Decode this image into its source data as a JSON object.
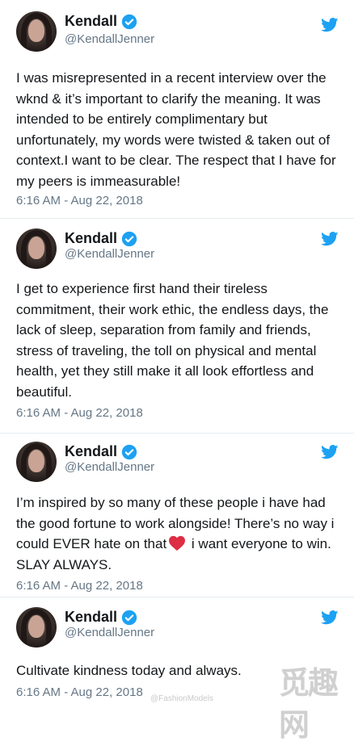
{
  "account": {
    "name": "Kendall",
    "handle": "@KendallJenner",
    "verified": true,
    "brand_color": "#1da1f2"
  },
  "tweets": [
    {
      "text": "I was misrepresented in a recent interview over the wknd & it’s important to clarify the meaning. It was intended to be entirely complimentary but unfortunately, my words were twisted & taken out of context.I want to be clear. The respect that I have for my peers is immeasurable!",
      "timestamp": "6:16 AM - Aug 22, 2018"
    },
    {
      "text": "I get to experience first hand their tireless commitment, their work ethic, the endless days, the lack of sleep, separation from family and friends, stress of traveling, the toll on physical and mental health, yet they still make it all look effortless and beautiful.",
      "timestamp": "6:16 AM - Aug 22, 2018"
    },
    {
      "text_before_emoji": "I’m inspired by so many of these people i have had the good fortune to work alongside! There’s no way i could EVER hate on that",
      "emoji": "red-heart-icon",
      "text_after_emoji": " i want everyone to win. SLAY ALWAYS.",
      "timestamp": "6:16 AM - Aug 22, 2018"
    },
    {
      "text": "Cultivate kindness today and always.",
      "timestamp": "6:16 AM - Aug 22, 2018"
    }
  ],
  "overlays": {
    "watermark_text": "@FashionModels",
    "corner_logo_text": "觅趣网"
  }
}
